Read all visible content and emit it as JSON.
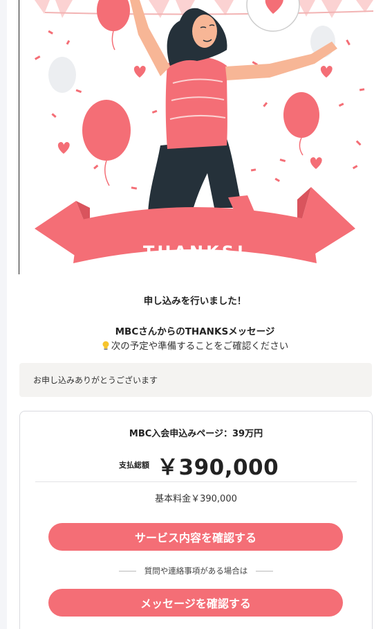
{
  "hero": {
    "banner_text": "THANKS!",
    "colors": {
      "accent": "#f46e76",
      "dark": "#25313a",
      "skin": "#f7b696",
      "light_pink": "#fbd2d2"
    }
  },
  "confirmation": {
    "title": "申し込みを行いました！",
    "message_title": "MBCさんからのTHANKSメッセージ",
    "hint_icon": "lightbulb-icon",
    "hint": "次の予定や準備することをご確認ください"
  },
  "notice": {
    "text": "お申し込みありがとうございます"
  },
  "order": {
    "title": "MBC入会申込みページ：39万円",
    "total_label": "支払総額",
    "total_amount": "￥390,000",
    "base_fee": "基本料金￥390,000"
  },
  "actions": {
    "service_button": "サービス内容を確認する",
    "separator": "質問や連絡事項がある場合は",
    "message_button": "メッセージを確認する"
  }
}
